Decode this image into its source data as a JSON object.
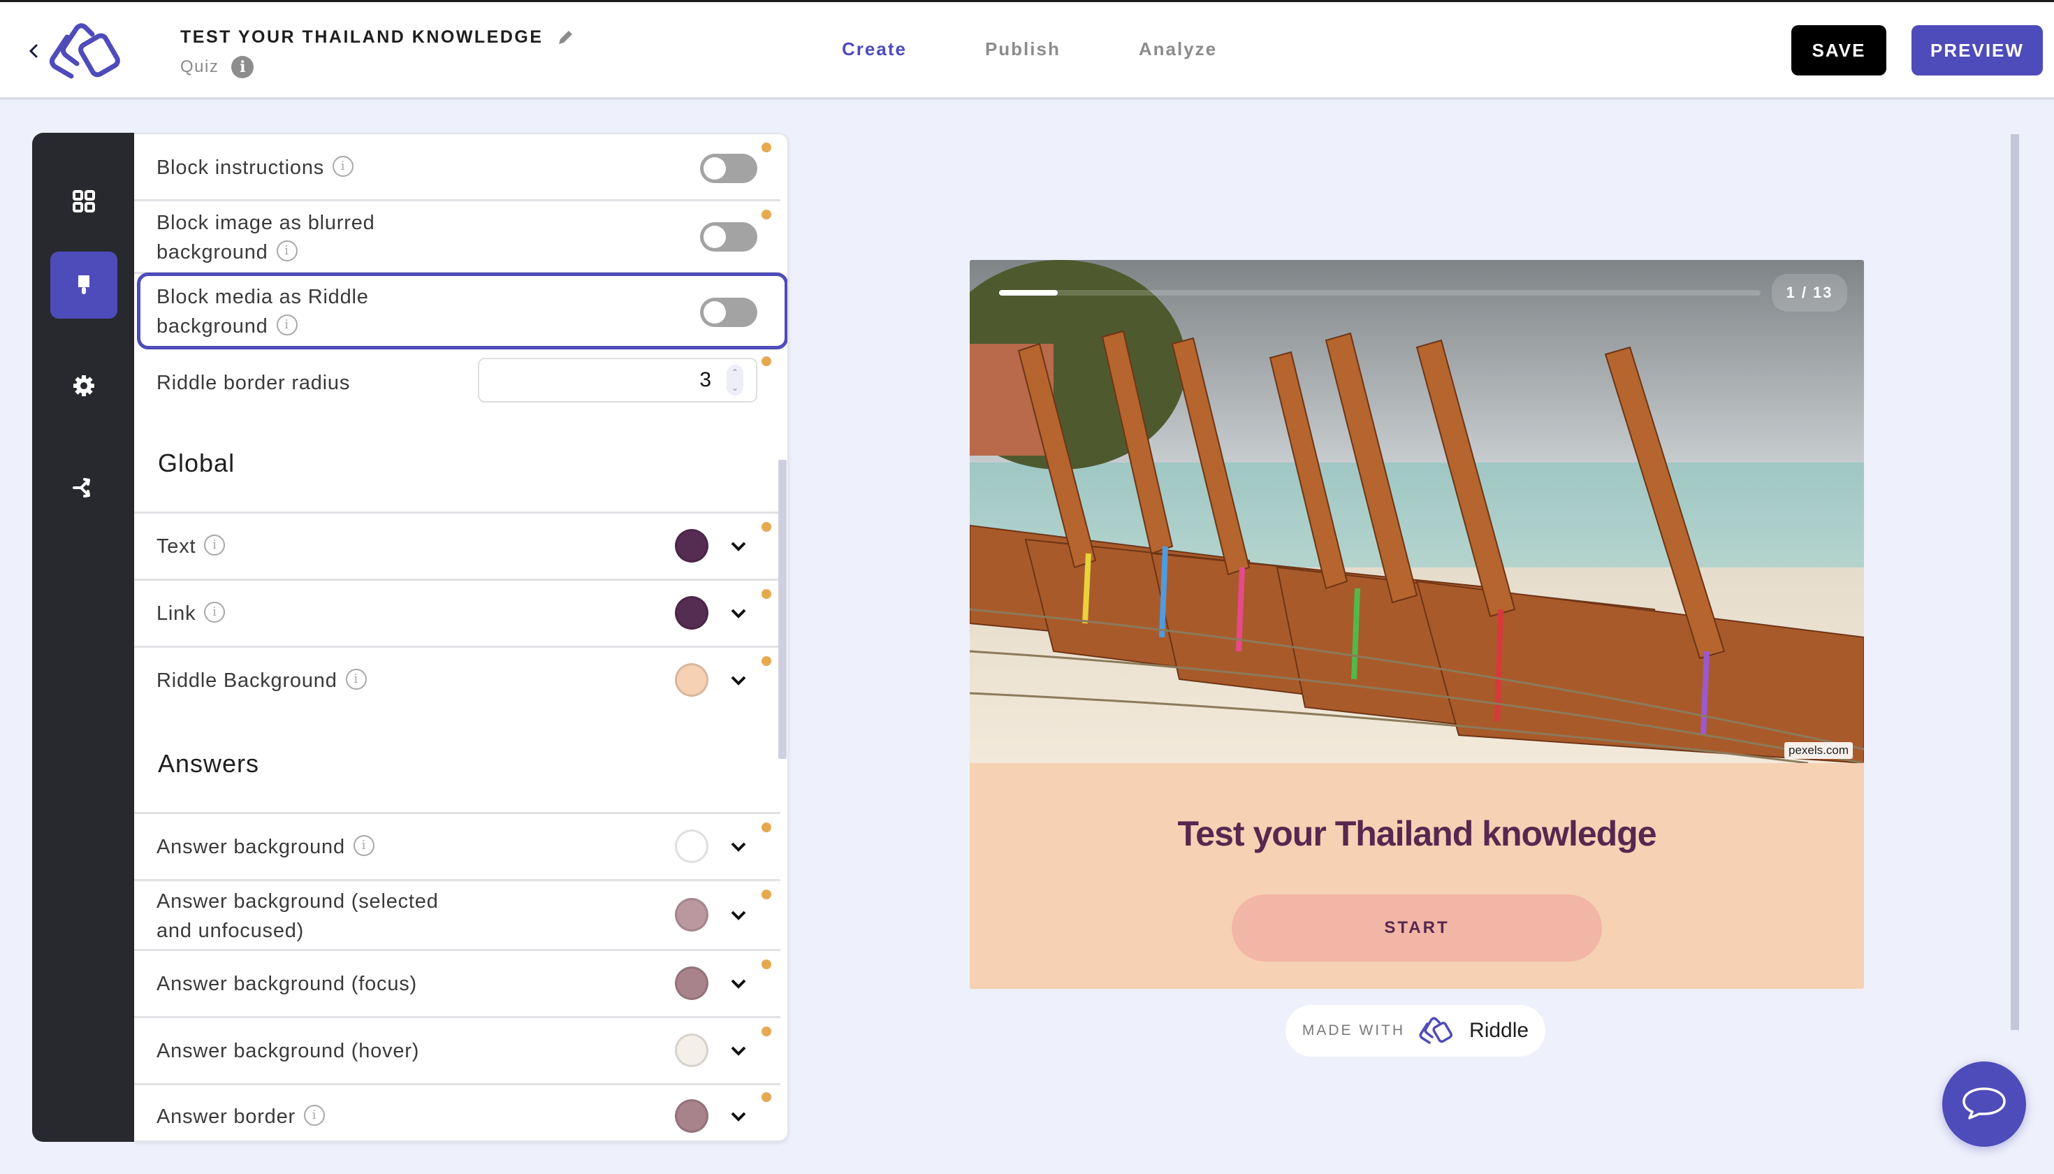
{
  "header": {
    "back_icon": "chevron-left-icon",
    "logo": "riddle-logo",
    "title": "TEST YOUR THAILAND KNOWLEDGE",
    "edit_icon": "pencil-icon",
    "subtitle": "Quiz",
    "info_icon": "info-icon",
    "info_glyph": "i",
    "nav": [
      {
        "label": "Create",
        "active": true
      },
      {
        "label": "Publish",
        "active": false
      },
      {
        "label": "Analyze",
        "active": false
      }
    ],
    "save_label": "SAVE",
    "preview_label": "PREVIEW"
  },
  "rail": {
    "items": [
      {
        "icon": "blocks-grid-icon",
        "active": false
      },
      {
        "icon": "paintbrush-icon",
        "active": true
      },
      {
        "icon": "gear-icon",
        "active": false
      },
      {
        "icon": "share-flow-icon",
        "active": false
      }
    ]
  },
  "panel": {
    "rows": [
      {
        "label": "Block instructions",
        "type": "toggle",
        "value": false,
        "info": true,
        "modified": true
      },
      {
        "label_line1": "Block image as blurred",
        "label_line2": "background",
        "type": "toggle",
        "value": false,
        "info": true,
        "modified": true
      },
      {
        "label_line1": "Block media as Riddle",
        "label_line2": "background",
        "type": "toggle",
        "value": false,
        "info": true,
        "modified": false,
        "focused": true
      },
      {
        "label": "Riddle border radius",
        "type": "number",
        "value": "3",
        "modified": true
      }
    ],
    "sections": [
      {
        "title": "Global",
        "rows": [
          {
            "label": "Text",
            "color": "#552c52",
            "info": true,
            "modified": true
          },
          {
            "label": "Link",
            "color": "#552c52",
            "info": true,
            "modified": true
          },
          {
            "label": "Riddle Background",
            "color": "#f7d1b4",
            "info": true,
            "modified": true
          }
        ]
      },
      {
        "title": "Answers",
        "rows": [
          {
            "label": "Answer background",
            "color": "#ffffff",
            "info": true,
            "modified": true
          },
          {
            "label_line1": "Answer background (selected",
            "label_line2": "and unfocused)",
            "color": "#bb98a0",
            "info": false,
            "modified": true
          },
          {
            "label": "Answer background (focus)",
            "color": "#a8838c",
            "info": false,
            "modified": true
          },
          {
            "label": "Answer background (hover)",
            "color": "#f4efe9",
            "info": false,
            "modified": true
          },
          {
            "label": "Answer border",
            "color": "#a8838c",
            "info": true,
            "modified": true
          }
        ]
      }
    ],
    "modified_dot_color": "#e6a94f",
    "chevron_icon": "chevron-down-icon"
  },
  "preview": {
    "progress": {
      "current": 1,
      "total": 13,
      "fraction": 0.077
    },
    "page_counter": "1 / 13",
    "image_credit": "pexels.com",
    "image_alt": "Longtail boats on a Thai beach",
    "quiz_title": "Test your Thailand knowledge",
    "start_label": "START",
    "made_with": "MADE WITH",
    "brand": "Riddle",
    "title_color": "#57284f",
    "background_color": "#f7d1b4",
    "button_color": "#f2b6a6"
  },
  "colors": {
    "accent": "#4e4bba",
    "page_bg": "#eef0fb",
    "rail_bg": "#28292e"
  },
  "chat_icon": "chat-bubble-icon"
}
